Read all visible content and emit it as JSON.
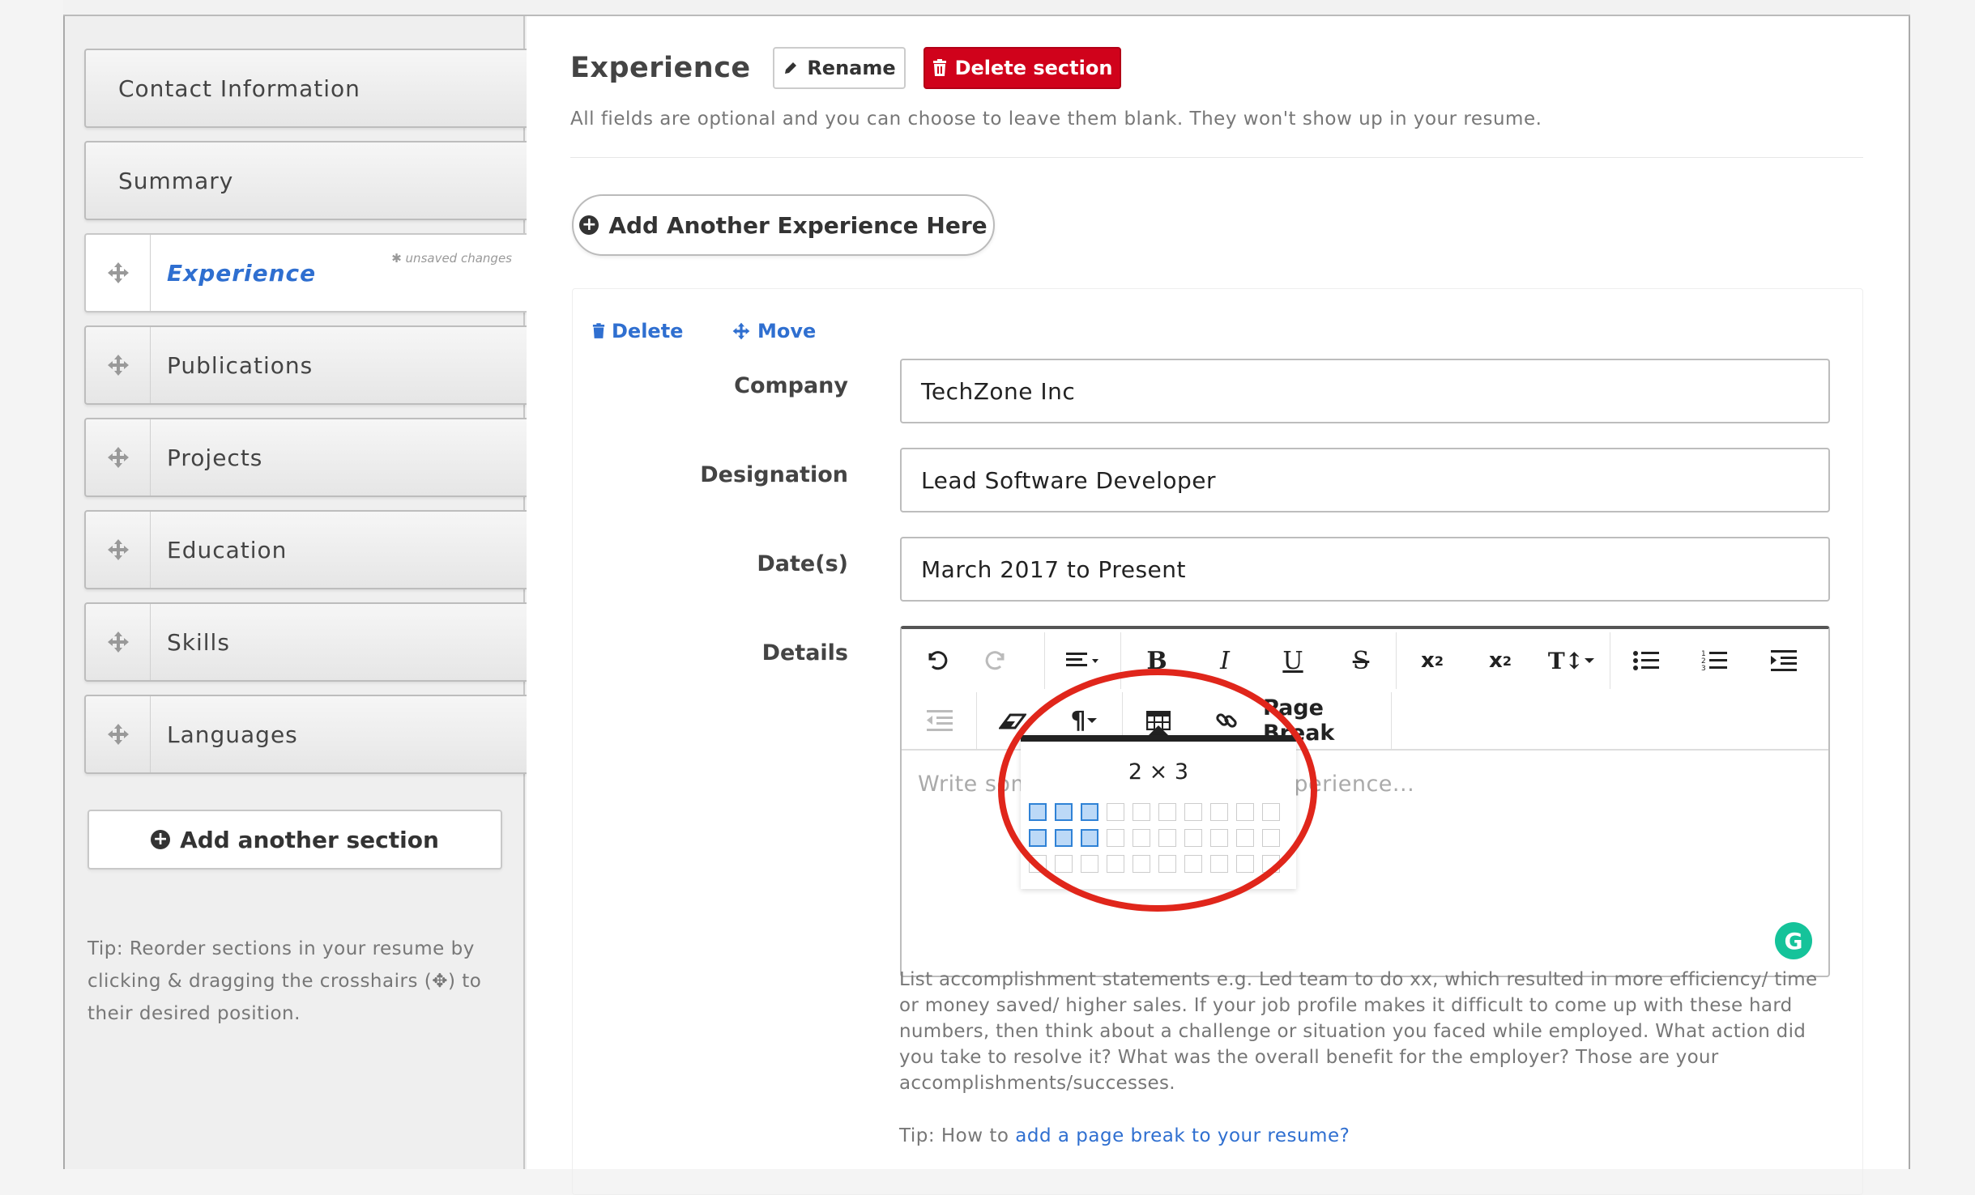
{
  "sidebar": {
    "sections": [
      {
        "label": "Contact Information",
        "handle": false
      },
      {
        "label": "Summary",
        "handle": false
      },
      {
        "label": "Experience",
        "handle": true,
        "active": true,
        "note": "✱ unsaved changes"
      },
      {
        "label": "Publications",
        "handle": true
      },
      {
        "label": "Projects",
        "handle": true
      },
      {
        "label": "Education",
        "handle": true
      },
      {
        "label": "Skills",
        "handle": true
      },
      {
        "label": "Languages",
        "handle": true
      }
    ],
    "add_section_label": "Add another section",
    "tip": "Tip: Reorder sections in your resume by clicking & dragging the crosshairs (✥) to their desired position."
  },
  "main": {
    "title": "Experience",
    "rename_label": "Rename",
    "delete_section_label": "Delete section",
    "subtitle": "All fields are optional and you can choose to leave them blank. They won't show up in your resume.",
    "add_experience_label": "Add Another Experience Here"
  },
  "entry": {
    "delete_label": "Delete",
    "move_label": "Move",
    "fields": {
      "company": {
        "label": "Company",
        "value": "TechZone Inc"
      },
      "designation": {
        "label": "Designation",
        "value": "Lead Software Developer"
      },
      "dates": {
        "label": "Date(s)",
        "value": "March 2017 to Present"
      },
      "details": {
        "label": "Details"
      }
    },
    "editor": {
      "placeholder": "Write some details about your experience...",
      "page_break_label": "Page Break",
      "table_picker": {
        "size_label": "2 × 3",
        "rows_selected": 2,
        "cols_selected": 3,
        "grid_rows": 3,
        "grid_cols": 10
      }
    },
    "help_text": "List accomplishment statements e.g. Led team to do xx, which resulted in more efficiency/ time or money saved/ higher sales. If your job profile makes it difficult to come up with these hard numbers, then think about a challenge or situation you faced while employed. What action did you take to resolve it? What was the overall benefit for the employer? Those are your accomplishments/successes.",
    "tip_prefix": "Tip: How to ",
    "tip_link": "add a page break to your resume?"
  },
  "colors": {
    "accent": "#2f6fd0",
    "danger": "#d0021b",
    "highlight_ring": "#e0261b",
    "grammarly": "#15c39a"
  }
}
